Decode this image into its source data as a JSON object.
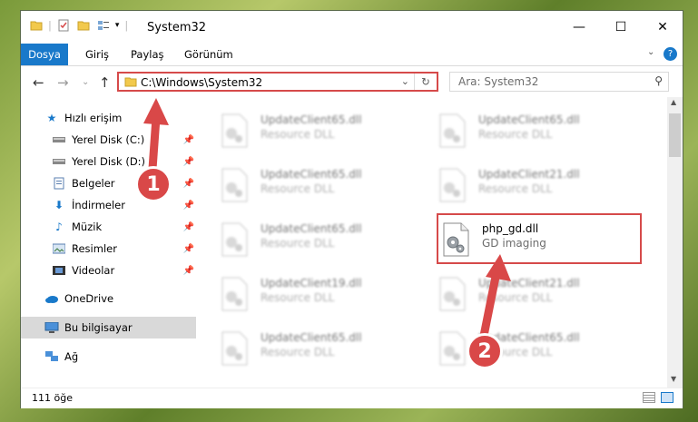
{
  "titlebar": {
    "title": "System32",
    "minimize": "—",
    "maximize": "☐",
    "close": "✕"
  },
  "ribbon": {
    "tabs": [
      "Dosya",
      "Giriş",
      "Paylaş",
      "Görünüm"
    ]
  },
  "address": {
    "path": "C:\\Windows\\System32",
    "search_placeholder": "Ara: System32"
  },
  "nav": {
    "quick_access": "Hızlı erişim",
    "items": [
      {
        "label": "Yerel Disk (C:)",
        "icon": "drive-icon"
      },
      {
        "label": "Yerel Disk (D:)",
        "icon": "drive-icon"
      },
      {
        "label": "Belgeler",
        "icon": "documents-icon"
      },
      {
        "label": "İndirmeler",
        "icon": "downloads-icon"
      },
      {
        "label": "Müzik",
        "icon": "music-icon"
      },
      {
        "label": "Resimler",
        "icon": "pictures-icon"
      },
      {
        "label": "Videolar",
        "icon": "videos-icon"
      }
    ],
    "onedrive": "OneDrive",
    "this_pc": "Bu bilgisayar",
    "network": "Ağ"
  },
  "files": [
    {
      "name": "UpdateClient65.dll",
      "type": "Resource DLL"
    },
    {
      "name": "UpdateClient65.dll",
      "type": "Resource DLL"
    },
    {
      "name": "UpdateClient65.dll",
      "type": "Resource DLL"
    },
    {
      "name": "UpdateClient21.dll",
      "type": "Resource DLL"
    },
    {
      "name": "UpdateClient65.dll",
      "type": "Resource DLL"
    },
    {
      "name": "php_gd.dll",
      "type": "GD imaging"
    },
    {
      "name": "UpdateClient19.dll",
      "type": "Resource DLL"
    },
    {
      "name": "UpdateClient21.dll",
      "type": "Resource DLL"
    },
    {
      "name": "UpdateClient65.dll",
      "type": "Resource DLL"
    },
    {
      "name": "UpdateClient65.dll",
      "type": "Resource DLL"
    }
  ],
  "status": {
    "count": "111 öğe"
  },
  "callouts": [
    "1",
    "2"
  ],
  "colors": {
    "accent": "#1979ca",
    "highlight": "#d64a4a"
  }
}
